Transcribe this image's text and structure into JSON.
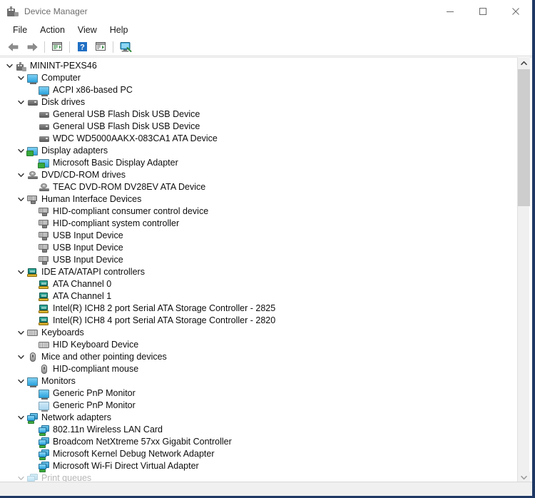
{
  "window": {
    "title": "Device Manager",
    "icon": "device-manager-icon",
    "controls": {
      "minimize": "Minimize",
      "maximize": "Maximize",
      "close": "Close"
    },
    "border_color": "#1f3864"
  },
  "menubar": {
    "items": [
      {
        "label": "File"
      },
      {
        "label": "Action"
      },
      {
        "label": "View"
      },
      {
        "label": "Help"
      }
    ]
  },
  "toolbar": {
    "buttons": [
      {
        "name": "back-button",
        "icon": "back-arrow-icon",
        "label": "Back"
      },
      {
        "name": "forward-button",
        "icon": "forward-arrow-icon",
        "label": "Forward"
      },
      {
        "name": "properties-button",
        "icon": "properties-icon",
        "label": "Properties"
      },
      {
        "name": "help-button",
        "icon": "help-question-icon",
        "label": "Help"
      },
      {
        "name": "update-driver-button",
        "icon": "update-driver-icon",
        "label": "Update driver"
      },
      {
        "name": "scan-hardware-button",
        "icon": "scan-hardware-icon",
        "label": "Scan for hardware changes"
      }
    ]
  },
  "tree": {
    "nodes": [
      {
        "label": "MININT-PEXS46",
        "level": 0,
        "expanded": true,
        "icon": "computer-root-icon"
      },
      {
        "label": "Computer",
        "level": 1,
        "expanded": true,
        "icon": "computer-icon"
      },
      {
        "label": "ACPI x86-based PC",
        "level": 2,
        "icon": "computer-icon"
      },
      {
        "label": "Disk drives",
        "level": 1,
        "expanded": true,
        "icon": "disk-drive-icon"
      },
      {
        "label": "General USB Flash Disk USB Device",
        "level": 2,
        "icon": "disk-drive-icon"
      },
      {
        "label": "General USB Flash Disk USB Device",
        "level": 2,
        "icon": "disk-drive-icon"
      },
      {
        "label": "WDC WD5000AAKX-083CA1 ATA Device",
        "level": 2,
        "icon": "disk-drive-icon"
      },
      {
        "label": "Display adapters",
        "level": 1,
        "expanded": true,
        "icon": "display-adapter-icon"
      },
      {
        "label": "Microsoft Basic Display Adapter",
        "level": 2,
        "icon": "display-adapter-icon"
      },
      {
        "label": "DVD/CD-ROM drives",
        "level": 1,
        "expanded": true,
        "icon": "dvd-drive-icon"
      },
      {
        "label": "TEAC DVD-ROM DV28EV ATA Device",
        "level": 2,
        "icon": "dvd-drive-icon"
      },
      {
        "label": "Human Interface Devices",
        "level": 1,
        "expanded": true,
        "icon": "hid-icon"
      },
      {
        "label": "HID-compliant consumer control device",
        "level": 2,
        "icon": "hid-icon"
      },
      {
        "label": "HID-compliant system controller",
        "level": 2,
        "icon": "hid-icon"
      },
      {
        "label": "USB Input Device",
        "level": 2,
        "icon": "hid-icon"
      },
      {
        "label": "USB Input Device",
        "level": 2,
        "icon": "hid-icon"
      },
      {
        "label": "USB Input Device",
        "level": 2,
        "icon": "hid-icon"
      },
      {
        "label": "IDE ATA/ATAPI controllers",
        "level": 1,
        "expanded": true,
        "icon": "ide-controller-icon"
      },
      {
        "label": "ATA Channel 0",
        "level": 2,
        "icon": "ide-controller-icon"
      },
      {
        "label": "ATA Channel 1",
        "level": 2,
        "icon": "ide-controller-icon"
      },
      {
        "label": "Intel(R) ICH8 2 port Serial ATA Storage Controller - 2825",
        "level": 2,
        "icon": "ide-controller-icon"
      },
      {
        "label": "Intel(R) ICH8 4 port Serial ATA Storage Controller - 2820",
        "level": 2,
        "icon": "ide-controller-icon"
      },
      {
        "label": "Keyboards",
        "level": 1,
        "expanded": true,
        "icon": "keyboard-icon"
      },
      {
        "label": "HID Keyboard Device",
        "level": 2,
        "icon": "keyboard-icon"
      },
      {
        "label": "Mice and other pointing devices",
        "level": 1,
        "expanded": true,
        "icon": "mouse-icon"
      },
      {
        "label": "HID-compliant mouse",
        "level": 2,
        "icon": "mouse-icon"
      },
      {
        "label": "Monitors",
        "level": 1,
        "expanded": true,
        "icon": "monitor-icon"
      },
      {
        "label": "Generic PnP Monitor",
        "level": 2,
        "icon": "monitor-icon"
      },
      {
        "label": "Generic PnP Monitor",
        "level": 2,
        "icon": "monitor-pale-icon"
      },
      {
        "label": "Network adapters",
        "level": 1,
        "expanded": true,
        "icon": "network-adapter-icon"
      },
      {
        "label": "802.11n Wireless LAN Card",
        "level": 2,
        "icon": "network-adapter-icon"
      },
      {
        "label": "Broadcom NetXtreme 57xx Gigabit Controller",
        "level": 2,
        "icon": "network-adapter-icon"
      },
      {
        "label": "Microsoft Kernel Debug Network Adapter",
        "level": 2,
        "icon": "network-adapter-icon"
      },
      {
        "label": "Microsoft Wi-Fi Direct Virtual Adapter",
        "level": 2,
        "icon": "network-adapter-icon"
      },
      {
        "label": "Print queues",
        "level": 1,
        "expanded": true,
        "icon": "print-queue-icon",
        "clipped": true
      }
    ]
  },
  "scrollbar": {
    "up_arrow": "scroll-up-icon",
    "down_arrow": "scroll-down-icon",
    "thumb": "scrollbar-thumb"
  }
}
